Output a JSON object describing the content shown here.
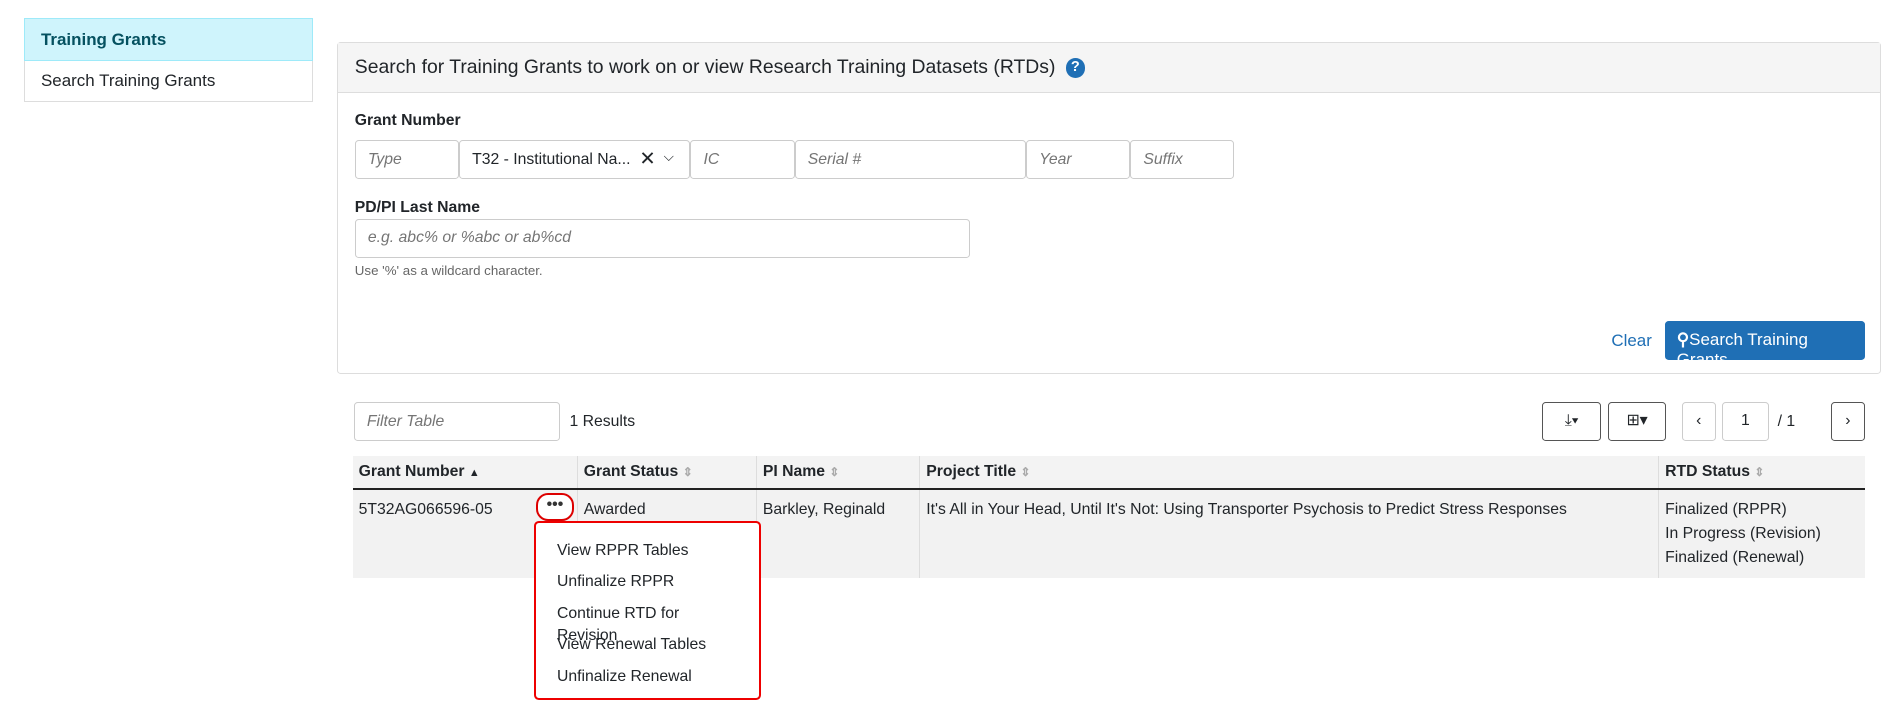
{
  "sidebar": {
    "header": "Training Grants",
    "items": [
      {
        "label": "Search Training Grants"
      }
    ]
  },
  "search": {
    "title": "Search for Training Grants to work on or view Research Training Datasets (RTDs)",
    "help_icon": "question-circle-icon",
    "grant_number_label": "Grant Number",
    "type_placeholder": "Type",
    "activity_value": "T32 - Institutional Na...",
    "ic_placeholder": "IC",
    "serial_placeholder": "Serial #",
    "year_placeholder": "Year",
    "suffix_placeholder": "Suffix",
    "pi_label": "PD/PI Last Name",
    "pi_placeholder": "e.g. abc% or %abc or ab%cd",
    "pi_help": "Use '%' as a wildcard character.",
    "clear_label": "Clear",
    "search_label": "Search Training Grants"
  },
  "results": {
    "filter_placeholder": "Filter Table",
    "count": "1 Results",
    "page": "1",
    "page_total": "/ 1",
    "columns": [
      "Grant Number",
      "Grant Status",
      "PI Name",
      "Project Title",
      "RTD Status"
    ],
    "rows": [
      {
        "grant_number": "5T32AG066596-05",
        "grant_status": "Awarded",
        "pi_name": "Barkley, Reginald",
        "project_title": "It's All in Your Head, Until It's Not: Using Transporter Psychosis to Predict Stress Responses",
        "rtd_status": [
          "Finalized (RPPR)",
          "In Progress (Revision)",
          "Finalized (Renewal)"
        ]
      }
    ],
    "actions_menu": [
      "View RPPR Tables",
      "Unfinalize RPPR",
      "Continue RTD for Revision",
      "View Renewal Tables",
      "Unfinalize Renewal"
    ]
  },
  "colors": {
    "primary": "#1f6fb5",
    "highlight": "#dd0000",
    "sidebar_active": "#cff4fc"
  }
}
